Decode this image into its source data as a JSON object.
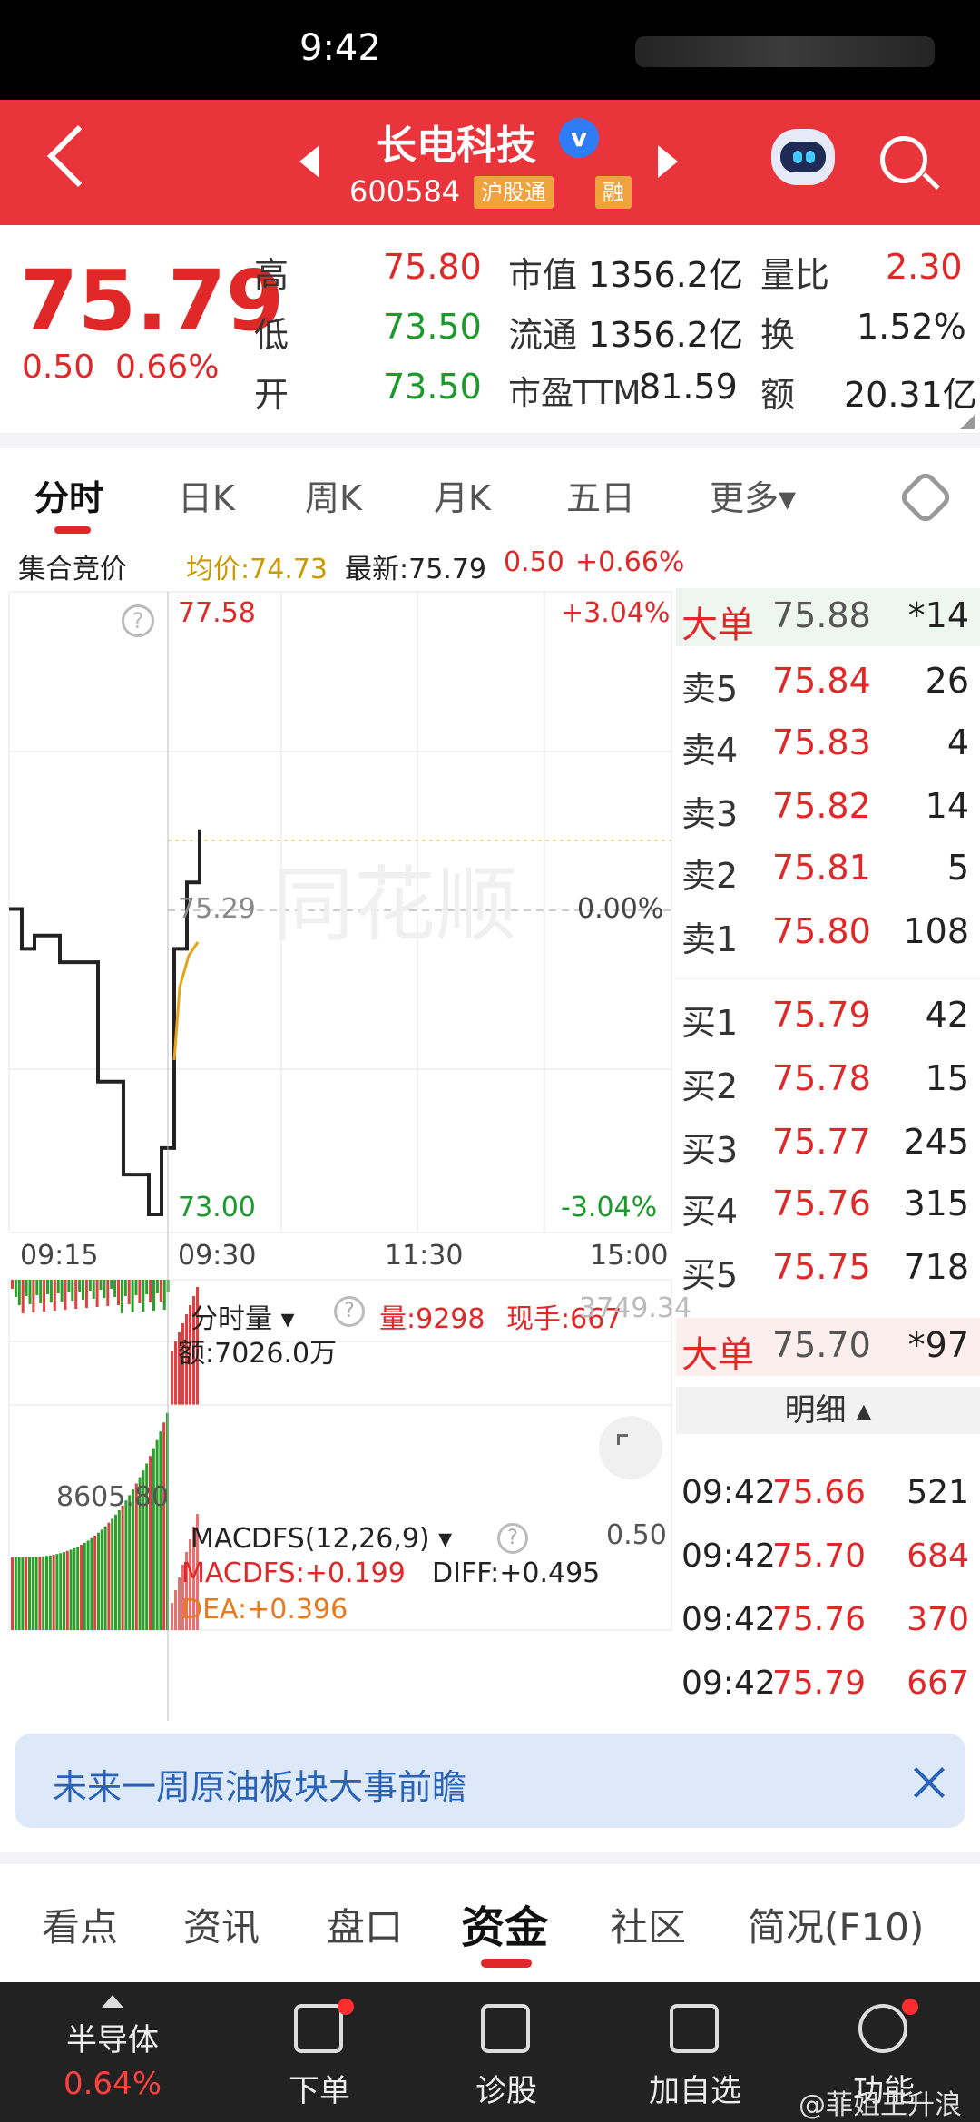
{
  "status": {
    "time": "9:42"
  },
  "header": {
    "name": "长电科技",
    "verified": "v",
    "code": "600584",
    "tag1": "沪股通",
    "tag2": "融"
  },
  "quote": {
    "price": "75.79",
    "change": "0.50",
    "change_pct": "0.66%",
    "rows": [
      {
        "l1": "高",
        "v1": "75.80",
        "l2": "市值",
        "v2": "1356.2亿",
        "l3": "量比",
        "v3": "2.30"
      },
      {
        "l1": "低",
        "v1": "73.50",
        "l2": "流通",
        "v2": "1356.2亿",
        "l3": "换",
        "v3": "1.52%"
      },
      {
        "l1": "开",
        "v1": "73.50",
        "l2": "市盈TTM",
        "v2": "81.59",
        "l3": "额",
        "v3": "20.31亿"
      }
    ]
  },
  "tabs": [
    "分时",
    "日K",
    "周K",
    "月K",
    "五日",
    "更多▾"
  ],
  "infoline": {
    "auction": "集合竞价",
    "avg": "均价:74.73",
    "latest": "最新:75.79",
    "chg": "0.50",
    "pct": "+0.66%"
  },
  "chart": {
    "y_top": "77.58",
    "y_mid": "75.29",
    "y_bot": "73.00",
    "pct_top": "+3.04%",
    "pct_mid": "0.00%",
    "pct_bot": "-3.04%",
    "x_ticks": [
      "09:15",
      "09:30",
      "11:30",
      "15:00"
    ],
    "vol_label": "分时量",
    "vol_qty": "量:9298",
    "vol_now": "现手:667",
    "vol_cut": "3749.34",
    "vol_amt": "额:7026.0万",
    "vol_left": "8605.80",
    "macd_title": "MACDFS(12,26,9)",
    "macd_val": "MACDFS:+0.199",
    "diff_val": "DIFF:+0.495",
    "dea_val": "DEA:+0.396",
    "macd_right": "0.50"
  },
  "chart_data": {
    "type": "line",
    "title": "",
    "xlabel": "",
    "ylabel": "",
    "ylim": [
      73.0,
      77.58
    ],
    "x_ticks": [
      "09:15",
      "09:30",
      "11:30",
      "15:00"
    ],
    "series": [
      {
        "values": [
          75.3,
          75.0,
          75.1,
          75.1,
          74.9,
          74.9,
          74.9,
          74.0,
          74.0,
          73.3,
          73.3,
          73.0,
          73.5,
          75.0,
          75.5,
          75.9
        ]
      }
    ]
  },
  "book": {
    "big_top": {
      "label": "大单",
      "price": "75.88",
      "vol": "*14"
    },
    "asks": [
      {
        "label": "卖5",
        "price": "75.84",
        "vol": "26"
      },
      {
        "label": "卖4",
        "price": "75.83",
        "vol": "4"
      },
      {
        "label": "卖3",
        "price": "75.82",
        "vol": "14"
      },
      {
        "label": "卖2",
        "price": "75.81",
        "vol": "5"
      },
      {
        "label": "卖1",
        "price": "75.80",
        "vol": "108"
      }
    ],
    "bids": [
      {
        "label": "买1",
        "price": "75.79",
        "vol": "42"
      },
      {
        "label": "买2",
        "price": "75.78",
        "vol": "15"
      },
      {
        "label": "买3",
        "price": "75.77",
        "vol": "245"
      },
      {
        "label": "买4",
        "price": "75.76",
        "vol": "315"
      },
      {
        "label": "买5",
        "price": "75.75",
        "vol": "718"
      }
    ],
    "big_bot": {
      "label": "大单",
      "price": "75.70",
      "vol": "*97"
    },
    "mingxi": "明细 ▴",
    "trades": [
      {
        "t": "09:42",
        "p": "75.66",
        "v": "521"
      },
      {
        "t": "09:42",
        "p": "75.70",
        "v": "684"
      },
      {
        "t": "09:42",
        "p": "75.76",
        "v": "370"
      },
      {
        "t": "09:42",
        "p": "75.79",
        "v": "667"
      }
    ]
  },
  "banner": {
    "text": "未来一周原油板块大事前瞻"
  },
  "section_tabs": [
    "看点",
    "资讯",
    "盘口",
    "资金",
    "社区",
    "简况(F10)"
  ],
  "bottom_nav": {
    "sector_name": "半导体",
    "sector_pct": "0.64%",
    "items": [
      "下单",
      "诊股",
      "加自选",
      "功能"
    ],
    "watermark": "@菲姐王升浪"
  }
}
